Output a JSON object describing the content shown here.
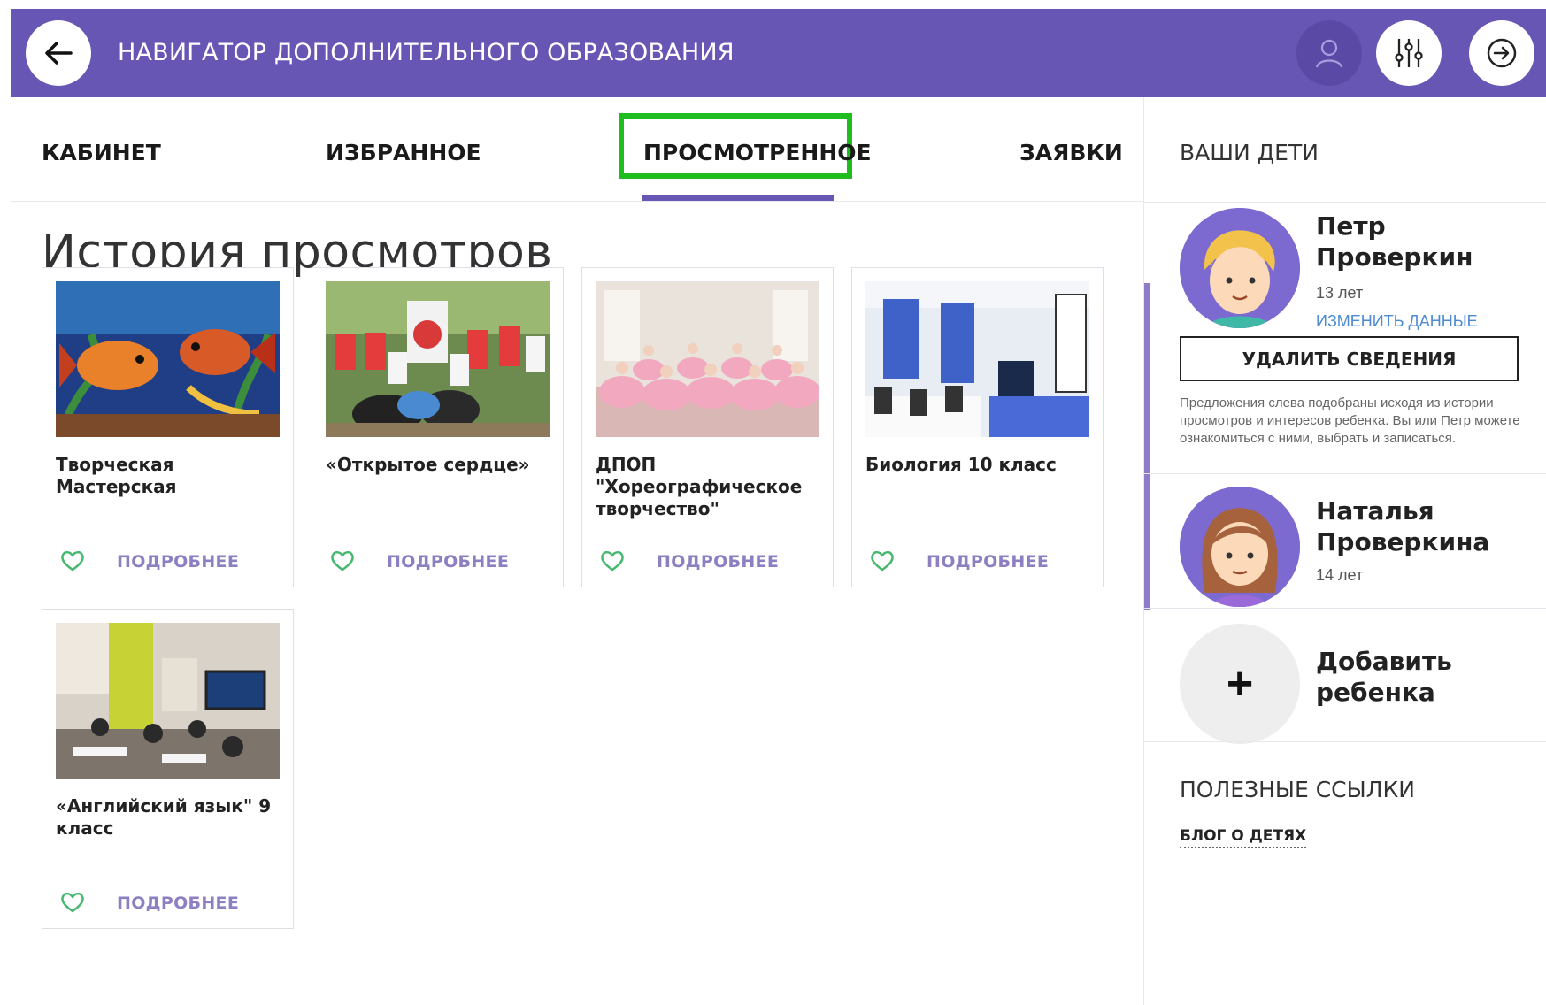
{
  "header": {
    "title": "НАВИГАТОР ДОПОЛНИТЕЛЬНОГО ОБРАЗОВАНИЯ",
    "back_icon": "arrow-left-icon",
    "profile_icon": "user-icon",
    "filter_icon": "sliders-icon",
    "exit_icon": "logout-icon",
    "brand_color": "#6756b3"
  },
  "tabs": [
    {
      "label": "КАБИНЕТ"
    },
    {
      "label": "ИЗБРАННОЕ"
    },
    {
      "label": "ПРОСМОТРЕННОЕ",
      "active": true
    },
    {
      "label": "ЗАЯВКИ"
    }
  ],
  "main": {
    "title": "История просмотров",
    "more_label": "ПОДРОБНЕЕ",
    "cards": [
      {
        "title": "Творческая Мастерская"
      },
      {
        "title": "«Открытое сердце»"
      },
      {
        "title": "ДПОП \"Хореографическое творчество\""
      },
      {
        "title": "Биология 10 класс"
      },
      {
        "title": "«Английский язык\" 9 класс"
      }
    ]
  },
  "sidebar": {
    "heading": "ВАШИ ДЕТИ",
    "children": [
      {
        "name": "Петр Проверкин",
        "age": "13 лет",
        "edit": "ИЗМЕНИТЬ ДАННЫЕ"
      },
      {
        "name": "Наталья Проверкина",
        "age": "14 лет"
      }
    ],
    "delete_label": "УДАЛИТЬ СВЕДЕНИЯ",
    "hint": "Предложения слева подобраны исходя из истории просмотров и интересов ребенка. Вы или Петр можете ознакомиться с ними, выбрать и записаться.",
    "add_child": "Добавить ребенка",
    "links_heading": "ПОЛЕЗНЫЕ ССЫЛКИ",
    "links": [
      {
        "label": "БЛОГ О ДЕТЯХ"
      }
    ]
  }
}
